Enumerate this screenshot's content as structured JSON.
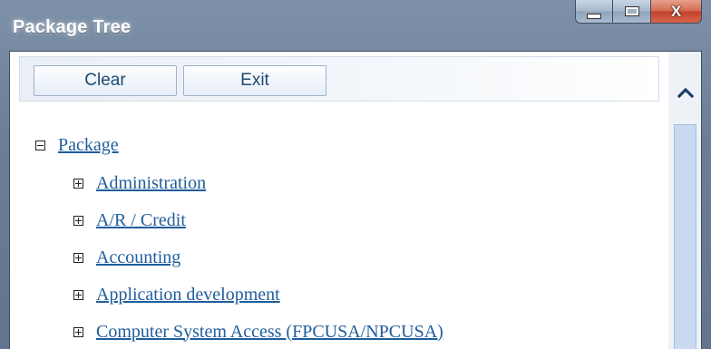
{
  "window": {
    "title": "Package Tree"
  },
  "toolbar": {
    "clear_label": "Clear",
    "exit_label": "Exit"
  },
  "tree": {
    "root": {
      "label": "Package",
      "expanded": true
    },
    "children": [
      {
        "label": "Administration",
        "expanded": false
      },
      {
        "label": "A/R / Credit",
        "expanded": false
      },
      {
        "label": "Accounting",
        "expanded": false
      },
      {
        "label": "Application development",
        "expanded": false
      },
      {
        "label": "Computer System Access (FPCUSA/NPCUSA)",
        "expanded": false
      }
    ]
  },
  "icons": {
    "minimize": "minimize-icon",
    "maximize": "maximize-icon",
    "close": "close-icon",
    "collapse": "minus-box-icon",
    "expand": "plus-box-icon",
    "scroll_up": "chevron-up-icon"
  },
  "colors": {
    "link": "#1f5d9c",
    "button_text": "#1c4a73",
    "scroll_thumb": "#c9daf0"
  }
}
